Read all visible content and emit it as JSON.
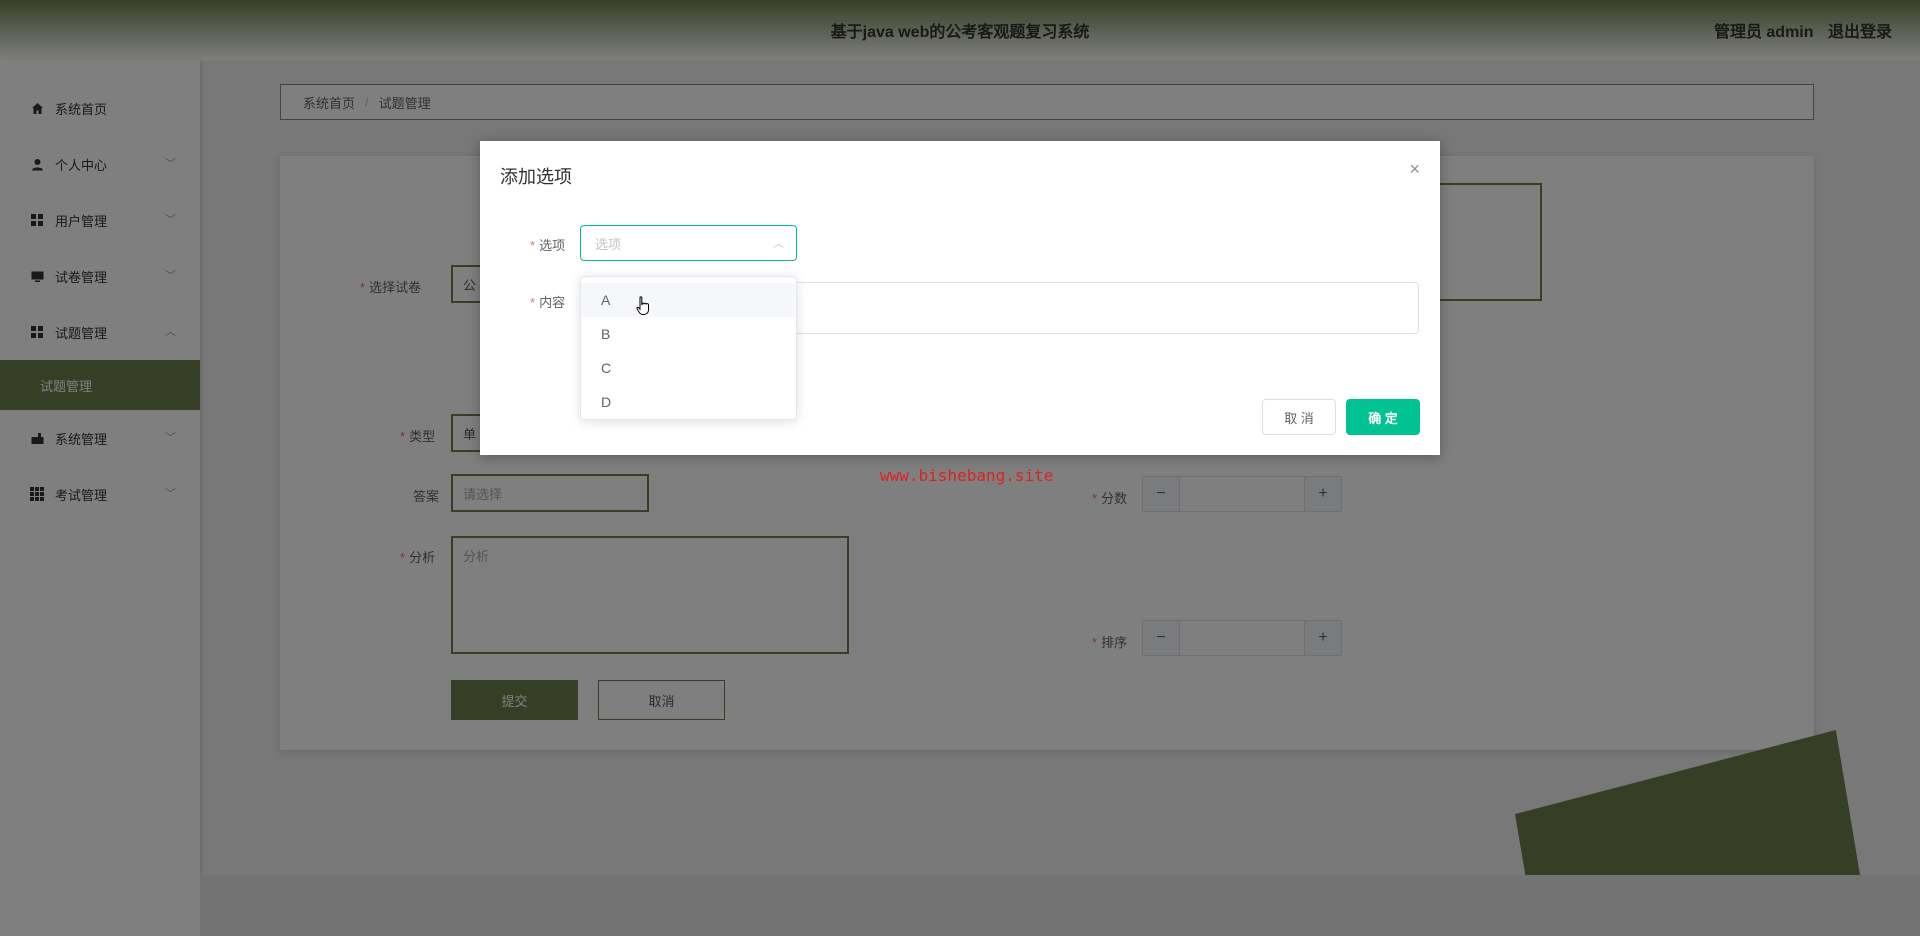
{
  "header": {
    "title": "基于java web的公考客观题复习系统",
    "user_label": "管理员 admin",
    "logout": "退出登录"
  },
  "sidebar": {
    "items": [
      {
        "label": "系统首页",
        "icon": "home-icon"
      },
      {
        "label": "个人中心",
        "icon": "user-icon"
      },
      {
        "label": "用户管理",
        "icon": "grid-icon"
      },
      {
        "label": "试卷管理",
        "icon": "monitor-icon"
      },
      {
        "label": "试题管理",
        "icon": "grid-icon"
      },
      {
        "label": "试题管理",
        "icon": ""
      },
      {
        "label": "系统管理",
        "icon": "settings-icon"
      },
      {
        "label": "考试管理",
        "icon": "apps-icon"
      }
    ]
  },
  "breadcrumb": {
    "home": "系统首页",
    "sep": "/",
    "current": "试题管理"
  },
  "form": {
    "paper_label": "选择试卷",
    "paper_value": "公",
    "type_label": "类型",
    "type_value": "单",
    "answer_label": "答案",
    "answer_placeholder": "请选择",
    "analysis_label": "分析",
    "analysis_placeholder": "分析",
    "score_label": "分数",
    "order_label": "排序",
    "stepper_minus": "−",
    "stepper_plus": "+",
    "submit": "提交",
    "cancel": "取消"
  },
  "watermark": "www.bishebang.site",
  "dialog": {
    "title": "添加选项",
    "close": "×",
    "option_label": "选项",
    "option_placeholder": "选项",
    "content_label": "内容",
    "cancel": "取 消",
    "confirm": "确 定",
    "options": [
      "A",
      "B",
      "C",
      "D"
    ],
    "accent_color": "#00c292"
  },
  "theme": {
    "primary": "#6d7f4b"
  }
}
